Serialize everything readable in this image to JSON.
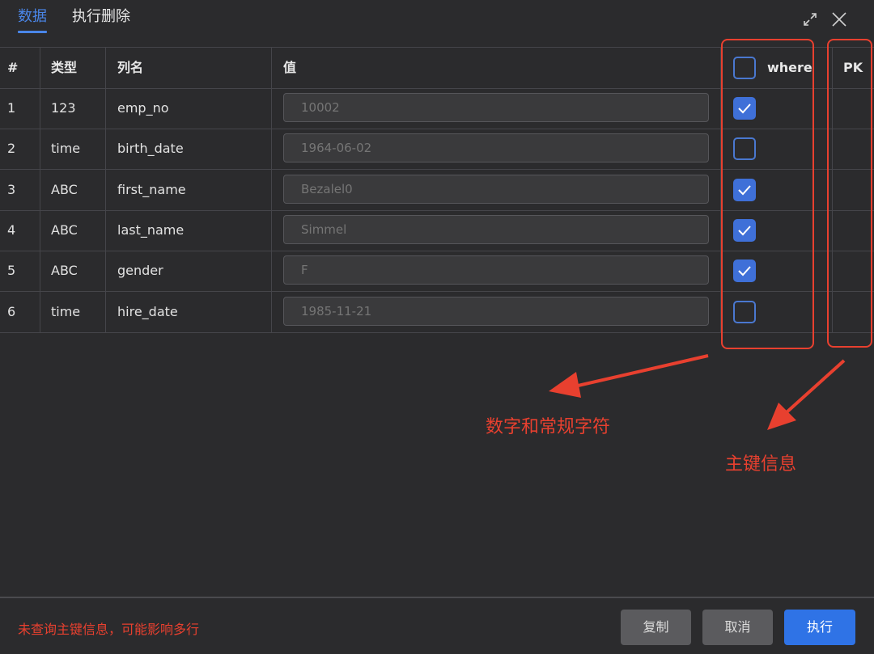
{
  "tabs": [
    {
      "label": "数据"
    },
    {
      "label": "执行删除"
    }
  ],
  "columns": {
    "index": "#",
    "type": "类型",
    "name": "列名",
    "value": "值",
    "where": "where",
    "pk": "PK"
  },
  "rows": [
    {
      "index": "1",
      "type": "123",
      "name": "emp_no",
      "value": "10002",
      "where": true
    },
    {
      "index": "2",
      "type": "time",
      "name": "birth_date",
      "value": "1964-06-02",
      "where": false
    },
    {
      "index": "3",
      "type": "ABC",
      "name": "first_name",
      "value": "Bezalel0",
      "where": true
    },
    {
      "index": "4",
      "type": "ABC",
      "name": "last_name",
      "value": "Simmel",
      "where": true
    },
    {
      "index": "5",
      "type": "ABC",
      "name": "gender",
      "value": "F",
      "where": true
    },
    {
      "index": "6",
      "type": "time",
      "name": "hire_date",
      "value": "1985-11-21",
      "where": false
    }
  ],
  "annotations": {
    "where_note": "数字和常规字符",
    "pk_note": "主键信息",
    "color": "#e8402f"
  },
  "footer": {
    "message": "未查询主键信息，可能影响多行",
    "copy_label": "复制",
    "cancel_label": "取消",
    "execute_label": "执行"
  },
  "icons": {
    "expand": "expand-icon",
    "close": "close-icon",
    "check": "checkmark-icon"
  },
  "colors": {
    "accent": "#4a86e8",
    "background": "#2b2b2d",
    "primary_button": "#2f73e6"
  }
}
